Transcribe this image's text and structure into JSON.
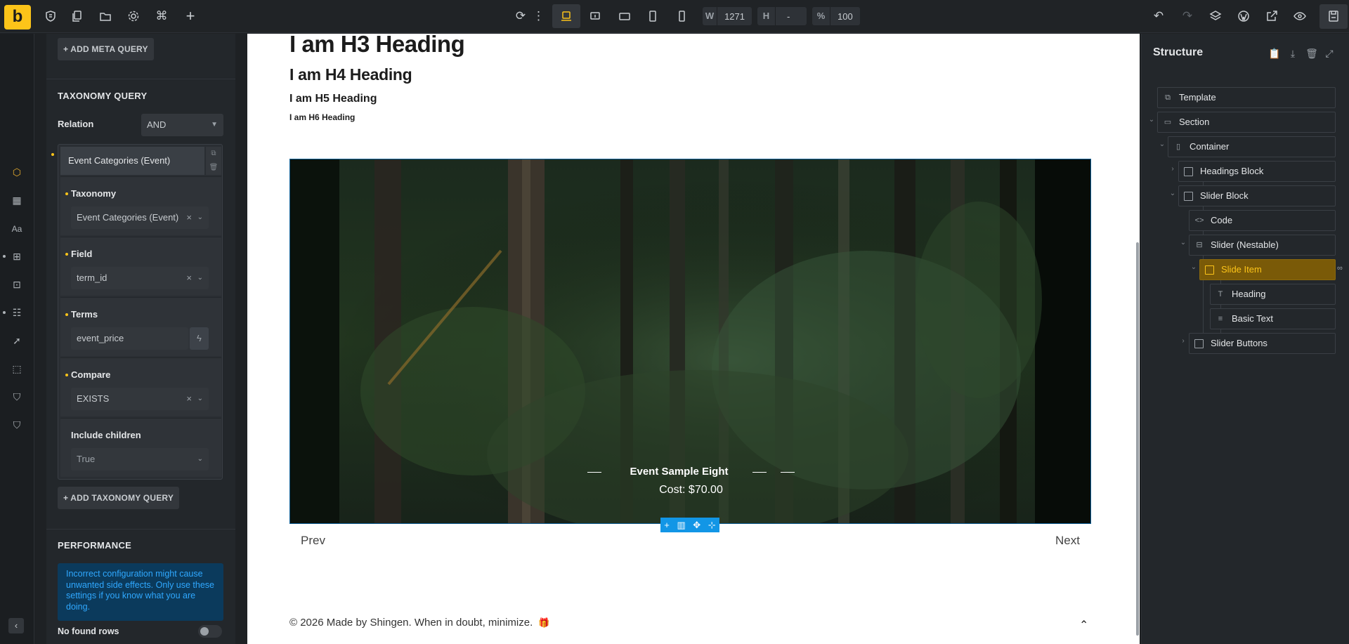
{
  "topbar": {
    "logo": "b",
    "width_label": "W",
    "width_value": "1271",
    "height_label": "H",
    "height_value": "-",
    "zoom_label": "%",
    "zoom_value": "100"
  },
  "left_panel": {
    "add_meta_query": "ADD META QUERY",
    "taxonomy_query_title": "TAXONOMY QUERY",
    "relation_label": "Relation",
    "relation_value": "AND",
    "repeater_item_title": "Event Categories (Event)",
    "taxonomy_label": "Taxonomy",
    "taxonomy_value": "Event Categories (Event)",
    "field_label": "Field",
    "field_value": "term_id",
    "terms_label": "Terms",
    "terms_value": "event_price",
    "compare_label": "Compare",
    "compare_value": "EXISTS",
    "include_children_label": "Include children",
    "include_children_value": "True",
    "add_taxonomy_query": "ADD TAXONOMY QUERY",
    "performance_title": "PERFORMANCE",
    "performance_info": "Incorrect configuration might cause unwanted side effects. Only use these settings if you know what you are doing.",
    "no_found_rows_label": "No found rows",
    "no_found_rows_on": false
  },
  "canvas": {
    "h3": "I am H3 Heading",
    "h4": "I am H4 Heading",
    "h5": "I am H5 Heading",
    "h6": "I am H6 Heading",
    "slide_title": "Event Sample Eight",
    "slide_cost": "Cost: $70.00",
    "prev": "Prev",
    "next": "Next",
    "footer": "© 2026 Made by Shingen. When in doubt, minimize."
  },
  "structure": {
    "title": "Structure",
    "nodes": [
      {
        "label": "Template",
        "icon": "template-icon"
      },
      {
        "label": "Section",
        "icon": "section-icon"
      },
      {
        "label": "Container",
        "icon": "container-icon"
      },
      {
        "label": "Headings Block",
        "icon": "block-icon"
      },
      {
        "label": "Slider Block",
        "icon": "block-icon"
      },
      {
        "label": "Code",
        "icon": "code-icon"
      },
      {
        "label": "Slider (Nestable)",
        "icon": "slider-icon"
      },
      {
        "label": "Slide Item",
        "icon": "block-icon",
        "selected": true
      },
      {
        "label": "Heading",
        "icon": "heading-icon"
      },
      {
        "label": "Basic Text",
        "icon": "text-icon"
      },
      {
        "label": "Slider Buttons",
        "icon": "block-icon"
      }
    ]
  },
  "colors": {
    "accent": "#fcc419",
    "info_bg": "#0b3a5c",
    "info_text": "#2fa8ff",
    "selected_node_bg": "#7a5a08",
    "canvas_toolbar": "#1296e6"
  }
}
